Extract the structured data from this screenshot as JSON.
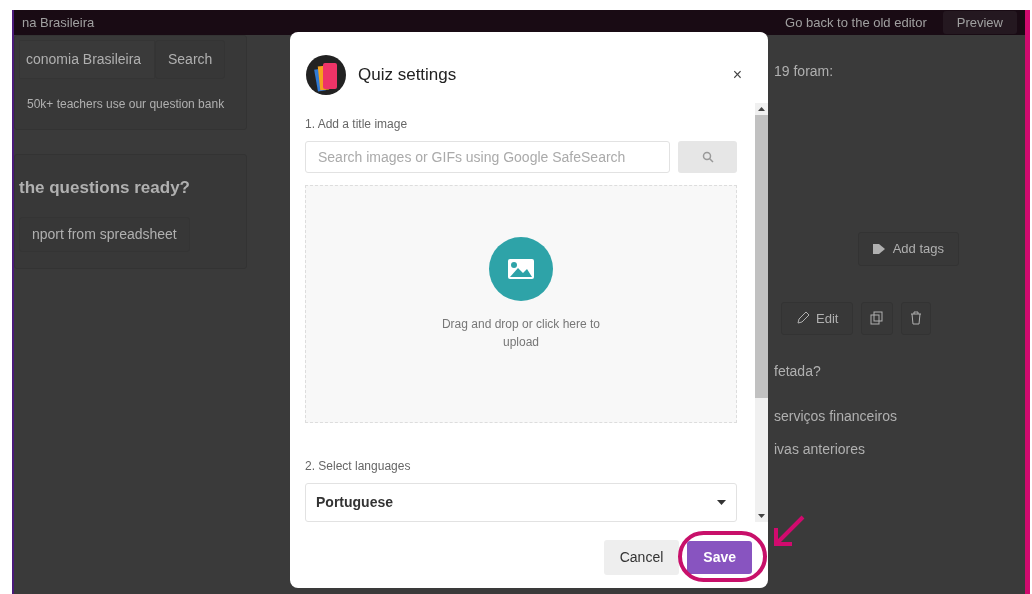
{
  "header": {
    "title_fragment": "na Brasileira",
    "old_editor_link": "Go back to the old editor",
    "preview_button": "Preview"
  },
  "left_panel": {
    "search_value": "conomia Brasileira",
    "search_button": "Search",
    "bank_note": "50k+ teachers use our question bank",
    "import_heading": "the questions ready?",
    "import_button": "nport from spreadsheet"
  },
  "question_panel": {
    "text_fragment": "19 foram:",
    "add_tags_button": "Add tags",
    "edit_button": "Edit",
    "question_fragment": "fetada?",
    "answers": [
      "serviços financeiros",
      "ivas anteriores"
    ]
  },
  "modal": {
    "title": "Quiz settings",
    "close": "×",
    "image_label": "1. Add a title image",
    "image_search_placeholder": "Search images or GIFs using Google SafeSearch",
    "dropzone_text": "Drag and drop or click here to upload",
    "language_label": "2. Select languages",
    "language_value": "Portuguese",
    "cancel_button": "Cancel",
    "save_button": "Save",
    "save_highlighted": true
  }
}
